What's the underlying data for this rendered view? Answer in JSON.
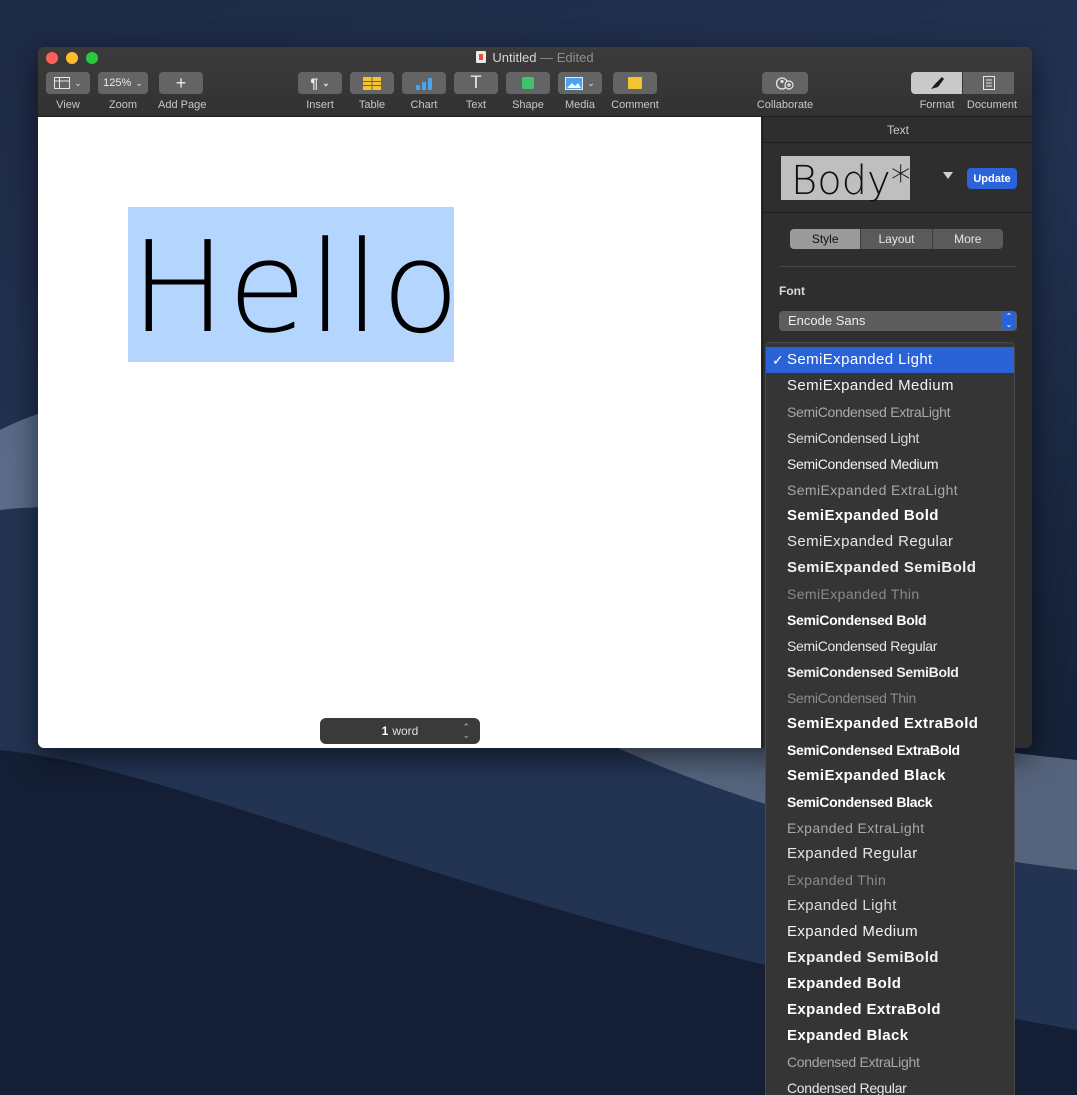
{
  "window": {
    "title": "Untitled",
    "status": "— Edited"
  },
  "toolbar": {
    "view": {
      "label": "View"
    },
    "zoom": {
      "value": "125%",
      "label": "Zoom"
    },
    "add_page": {
      "label": "Add Page"
    },
    "insert": {
      "label": "Insert"
    },
    "table": {
      "label": "Table"
    },
    "chart": {
      "label": "Chart"
    },
    "text": {
      "label": "Text"
    },
    "shape": {
      "label": "Shape"
    },
    "media": {
      "label": "Media"
    },
    "comment": {
      "label": "Comment"
    },
    "collaborate": {
      "label": "Collaborate"
    },
    "format": {
      "label": "Format"
    },
    "document": {
      "label": "Document"
    }
  },
  "canvas": {
    "text": "Hello",
    "word_count": {
      "number": "1",
      "unit": "word"
    }
  },
  "sidebar": {
    "header": "Text",
    "paragraph_style": "Body*",
    "update_label": "Update",
    "tabs": [
      {
        "label": "Style",
        "active": true
      },
      {
        "label": "Layout",
        "active": false
      },
      {
        "label": "More",
        "active": false
      }
    ],
    "font_label": "Font",
    "font_family": "Encode Sans"
  },
  "font_menu": {
    "selected": "SemiExpanded Light",
    "items": [
      {
        "label": "SemiExpanded Light",
        "weight": "w300",
        "width": "exp"
      },
      {
        "label": "SemiExpanded Medium",
        "weight": "w500",
        "width": "exp"
      },
      {
        "label": "SemiCondensed ExtraLight",
        "weight": "w200",
        "width": "cond"
      },
      {
        "label": "SemiCondensed Light",
        "weight": "w300",
        "width": "cond"
      },
      {
        "label": "SemiCondensed Medium",
        "weight": "w500",
        "width": "cond"
      },
      {
        "label": "SemiExpanded ExtraLight",
        "weight": "w200",
        "width": "exp"
      },
      {
        "label": "SemiExpanded Bold",
        "weight": "w700",
        "width": "exp"
      },
      {
        "label": "SemiExpanded Regular",
        "weight": "w400",
        "width": "exp"
      },
      {
        "label": "SemiExpanded SemiBold",
        "weight": "w600",
        "width": "exp"
      },
      {
        "label": "SemiExpanded Thin",
        "weight": "w100",
        "width": "exp"
      },
      {
        "label": "SemiCondensed Bold",
        "weight": "w700",
        "width": "cond"
      },
      {
        "label": "SemiCondensed Regular",
        "weight": "w400",
        "width": "cond"
      },
      {
        "label": "SemiCondensed SemiBold",
        "weight": "w600",
        "width": "cond"
      },
      {
        "label": "SemiCondensed Thin",
        "weight": "w100",
        "width": "cond"
      },
      {
        "label": "SemiExpanded ExtraBold",
        "weight": "w700",
        "width": "exp"
      },
      {
        "label": "SemiCondensed ExtraBold",
        "weight": "w700",
        "width": "cond"
      },
      {
        "label": "SemiExpanded Black",
        "weight": "w700",
        "width": "exp"
      },
      {
        "label": "SemiCondensed Black",
        "weight": "w700",
        "width": "cond"
      },
      {
        "label": "Expanded ExtraLight",
        "weight": "w200",
        "width": "exp"
      },
      {
        "label": "Expanded Regular",
        "weight": "w400",
        "width": "exp"
      },
      {
        "label": "Expanded Thin",
        "weight": "w100",
        "width": "exp"
      },
      {
        "label": "Expanded Light",
        "weight": "w300",
        "width": "exp"
      },
      {
        "label": "Expanded Medium",
        "weight": "w500",
        "width": "exp"
      },
      {
        "label": "Expanded SemiBold",
        "weight": "w600",
        "width": "exp"
      },
      {
        "label": "Expanded Bold",
        "weight": "w700",
        "width": "exp"
      },
      {
        "label": "Expanded ExtraBold",
        "weight": "w700",
        "width": "exp"
      },
      {
        "label": "Expanded Black",
        "weight": "w700",
        "width": "exp"
      },
      {
        "label": "Condensed ExtraLight",
        "weight": "w200",
        "width": "cond"
      },
      {
        "label": "Condensed Regular",
        "weight": "w400",
        "width": "cond"
      }
    ]
  },
  "colors": {
    "accent": "#2a63d8",
    "selection": "#b4d5fe",
    "update_button": "#2b63d9"
  }
}
